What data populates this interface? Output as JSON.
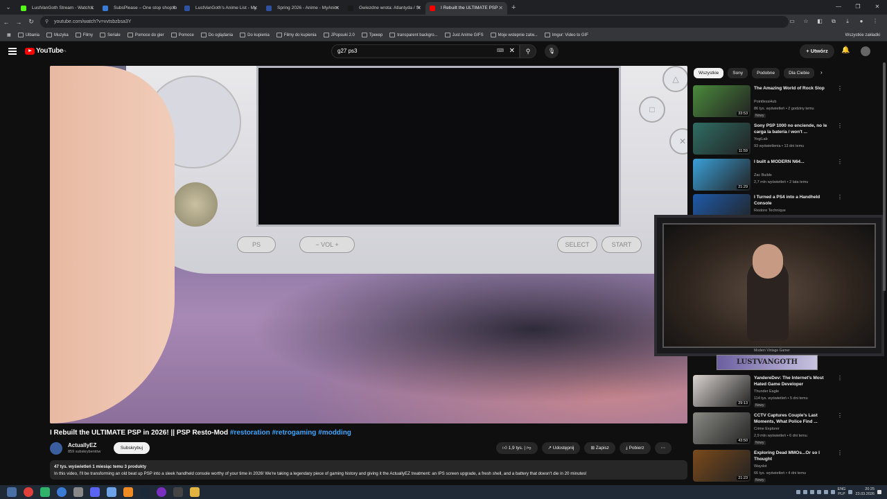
{
  "browser": {
    "tabs": [
      {
        "label": "LustVanGoth Stream - Watch L",
        "color": "#53fc18"
      },
      {
        "label": "SubsPlease – One stop shop fo",
        "color": "#3a7bd5"
      },
      {
        "label": "LustVanGoth's Anime List - My",
        "color": "#2e51a2"
      },
      {
        "label": "Spring 2026 - Anime - MyAnim",
        "color": "#2e51a2"
      },
      {
        "label": "Gwiezdne wrota: Atlantyda / St",
        "color": "#1a1a1a"
      },
      {
        "label": "I Rebuilt the ULTIMATE PSP",
        "color": "#ff0000",
        "active": true
      }
    ],
    "url": "youtube.com/watch?v=vvtsbzbsa3Y",
    "bookmarks": [
      "Ulbania",
      "Muzyka",
      "Filmy",
      "Seriale",
      "Pomoce do gier",
      "Pomoce",
      "Do oglądania",
      "Do kupienia",
      "Filmy do kupienia",
      "JPopsuki 2.0",
      "Трекер",
      "transparent backgro...",
      "Just Anime GIFS",
      "Moje wstepnie zatw...",
      "Imgur: Video to GIF"
    ],
    "bookmarks_right": "Wszystkie zakładki"
  },
  "yt": {
    "logo": "YouTube",
    "region": "PL",
    "search_query": "g27 ps3",
    "create_label": "Utwórz"
  },
  "video": {
    "title": "I Rebuilt the ULTIMATE PSP in 2026! || PSP Resto-Mod",
    "tags": "#restoration #retrogaming #modding",
    "channel": "ActuallyEZ",
    "subs": "859 subskrybentów",
    "subscribe_label": "Subskrybuj",
    "likes": "1,9 tys.",
    "share": "Udostępnij",
    "save": "Zapisz",
    "download": "Pobierz",
    "meta": "47 tys. wyświetleń  1 miesiąc temu  3 produkty",
    "description": "In this video, I'll be transforming an old beat up PSP into a sleek handheld console worthy of your time in 2026! We're taking a legendary piece of gaming history and giving it the ActuallyEZ treatment: an IPS screen upgrade, a fresh shell, and a battery that doesn't die in 20 minutes!",
    "psp_labels": {
      "vol": "VOL",
      "select": "SELECT",
      "start": "START"
    }
  },
  "chips": [
    "Wszystkie",
    "Sony",
    "Podobne",
    "Dla Ciebie"
  ],
  "recs": [
    {
      "title": "The Amazing World of Rock Slop",
      "channel": "PointlessHub",
      "views": "86 tys. wyświetleń • 2 godziny temu",
      "badge": "Nowy",
      "dur": "33:53",
      "color": "#4b8a3c"
    },
    {
      "title": "Sony PSP 1000 no enciende, no le carga la batería / won't ...",
      "channel": "YogiLab",
      "views": "93 wyświetlenia • 13 dni temu",
      "badge": "",
      "dur": "11:59",
      "color": "#2f6d64"
    },
    {
      "title": "I built a MODERN N64...",
      "channel": "Zac Builds",
      "views": "2,7 mln wyświetleń • 2 lata temu",
      "badge": "",
      "dur": "21:29",
      "color": "#3aa0d8"
    },
    {
      "title": "I Turned a PS4 into a Handheld Console",
      "channel": "Restore Technique",
      "views": "",
      "badge": "",
      "dur": "",
      "color": "#1e5aa8"
    },
    {
      "title": "YandereDev: The Internet's Most Hated Game Developer",
      "channel": "Thunder Eagle",
      "views": "114 tys. wyświetleń • 5 dni temu",
      "badge": "Nowy",
      "dur": "29:13",
      "color": "#d9d3cf"
    },
    {
      "title": "CCTV Captures Couple's Last Moments, What Police Find ...",
      "channel": "Crime Explorer",
      "views": "2,9 mln wyświetleń • 6 dni temu",
      "badge": "Nowy",
      "dur": "43:50",
      "color": "#8a8a84"
    },
    {
      "title": "Exploring Dead MMOs...Or so I Thought",
      "channel": "Waydot",
      "views": "66 tys. wyświetleń • 4 dni temu",
      "badge": "Nowy",
      "dur": "21:23",
      "color": "#7a4a1c"
    }
  ],
  "overlay": {
    "banner": "LUSTVANGOTH",
    "under_banner": "Modern Vintage Gamer"
  },
  "taskbar": {
    "lang": "ENG",
    "lang2": "PLP",
    "time": "20:25",
    "date": "23.03.2026"
  }
}
